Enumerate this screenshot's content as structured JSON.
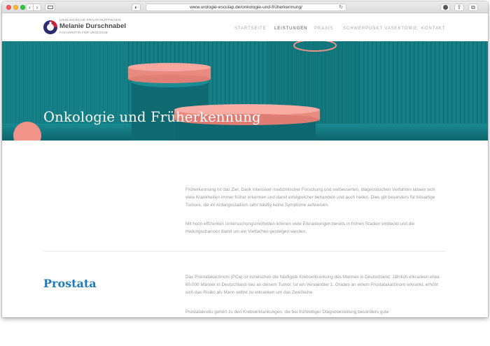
{
  "browser": {
    "url": "www.urologie-esculap.de/onkologie-und-früherkennung/",
    "back_glyph": "‹",
    "forward_glyph": "›",
    "reload_glyph": "↻",
    "shield_glyph": "◐",
    "share_glyph": "⇪",
    "tabs_glyph": "⧉"
  },
  "brand": {
    "top_line": "Urologische Privatarztpraxis",
    "name": "Melanie Durschnabel",
    "subtitle": "Fachärztin für Urologie",
    "colors": {
      "logo_dark": "#2d2c6e",
      "logo_red": "#c6263c"
    }
  },
  "nav": {
    "items": [
      {
        "label": "Startseite",
        "active": false
      },
      {
        "label": "Leistungen",
        "active": true
      },
      {
        "label": "Praxis",
        "active": false
      },
      {
        "label": "Schwerpunkt Vasektomie",
        "active": false
      },
      {
        "label": "Kontakt",
        "active": false
      }
    ]
  },
  "hero": {
    "title": "Onkologie und Früherkennung",
    "colors": {
      "teal": "#14787f",
      "coral": "#f2938a"
    }
  },
  "intro": {
    "paragraph1": "Früherkennung ist das Ziel. Dank intensiver medizinischer Forschung und verbesserten, diagnostischen Verfahren lassen sich viele Krankheiten immer früher erkennen und damit erfolgreicher behandeln und auch heilen. Dies gilt besonders für bösartige Tumore, die im Anfangsstadium sehr häufig keine Symptome aufweisen.",
    "paragraph2": "Mit hoch effizienten Untersuchungsmethoden können viele Erkrankungen bereits in frühen Stadien entdeckt  und die Heilungschancen damit um ein Vielfaches gesteigert werden."
  },
  "prostata": {
    "title": "Prostata",
    "paragraph1": "Das Prostatakarzinom (PCa) ist inzwischen die häufigste Krebserkrankung des Mannes in Deutschland. Jährlich erkranken etwa 60.000 Männer in Deutschland neu an diesem Tumor. Ist ein Verwandter 1. Grades an einem Prostatakarzinom erkrankt, erhöht sich das Risiko als Mann selbst zu erkranken um das Zweifache.",
    "paragraph2": "Prostatakrebs gehört zu den Krebserkrankungen, die bei frühzeitiger Diagnosestellung besonders gute"
  }
}
